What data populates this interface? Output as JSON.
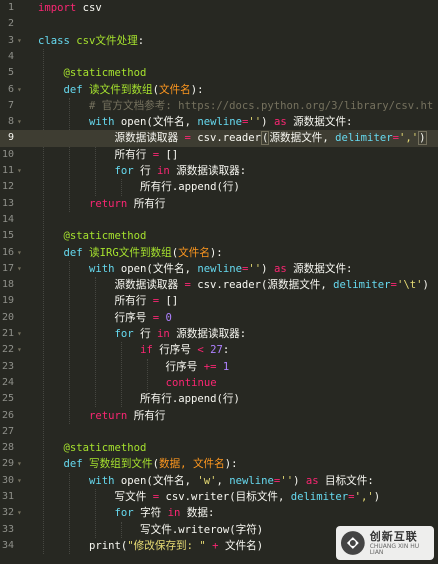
{
  "editor": {
    "theme_colors": {
      "background": "#272822",
      "keyword": "#66d9ef",
      "storage": "#f92672",
      "function": "#a6e22e",
      "string": "#e6db74",
      "number": "#ae81ff",
      "comment": "#75715e"
    },
    "active_line": 9,
    "lines": [
      {
        "n": "1",
        "fold": false,
        "tokens": [
          [
            "st",
            "import"
          ],
          [
            "pl",
            " csv"
          ]
        ]
      },
      {
        "n": "2",
        "fold": false,
        "tokens": []
      },
      {
        "n": "3",
        "fold": true,
        "tokens": [
          [
            "kw",
            "class"
          ],
          [
            "pl",
            " "
          ],
          [
            "fn",
            "csv文件处理"
          ],
          [
            "pl",
            ":"
          ]
        ]
      },
      {
        "n": "4",
        "fold": false,
        "tokens": []
      },
      {
        "n": "5",
        "fold": false,
        "tokens": [
          [
            "pl",
            "    "
          ],
          [
            "dc",
            "@staticmethod"
          ]
        ]
      },
      {
        "n": "6",
        "fold": true,
        "tokens": [
          [
            "pl",
            "    "
          ],
          [
            "kw",
            "def"
          ],
          [
            "pl",
            " "
          ],
          [
            "fn",
            "读文件到数组"
          ],
          [
            "pl",
            "("
          ],
          [
            "str2",
            "文件名"
          ],
          [
            "pl",
            "):"
          ]
        ]
      },
      {
        "n": "7",
        "fold": false,
        "tokens": [
          [
            "pl",
            "        "
          ],
          [
            "cm",
            "# 官方文档参考: https://docs.python.org/3/library/csv.ht"
          ]
        ]
      },
      {
        "n": "8",
        "fold": true,
        "tokens": [
          [
            "pl",
            "        "
          ],
          [
            "kw",
            "with"
          ],
          [
            "pl",
            " open(文件名, "
          ],
          [
            "kw",
            "newline"
          ],
          [
            "st",
            "="
          ],
          [
            "str",
            "''"
          ],
          [
            "pl",
            ") "
          ],
          [
            "st",
            "as"
          ],
          [
            "pl",
            " 源数据文件:"
          ]
        ]
      },
      {
        "n": "9",
        "fold": false,
        "tokens": [
          [
            "pl",
            "            源数据读取器 "
          ],
          [
            "st",
            "="
          ],
          [
            "pl",
            " csv.reader"
          ],
          [
            "br",
            "("
          ],
          [
            "pl",
            "源数据文件, "
          ],
          [
            "kw",
            "delimiter"
          ],
          [
            "st",
            "="
          ],
          [
            "str",
            "','"
          ],
          [
            "br",
            ")"
          ]
        ]
      },
      {
        "n": "10",
        "fold": false,
        "tokens": [
          [
            "pl",
            "            所有行 "
          ],
          [
            "st",
            "="
          ],
          [
            "pl",
            " []"
          ]
        ]
      },
      {
        "n": "11",
        "fold": true,
        "tokens": [
          [
            "pl",
            "            "
          ],
          [
            "kw",
            "for"
          ],
          [
            "pl",
            " 行 "
          ],
          [
            "st",
            "in"
          ],
          [
            "pl",
            " 源数据读取器:"
          ]
        ]
      },
      {
        "n": "12",
        "fold": false,
        "tokens": [
          [
            "pl",
            "                所有行.append(行)"
          ]
        ]
      },
      {
        "n": "13",
        "fold": false,
        "tokens": [
          [
            "pl",
            "        "
          ],
          [
            "st",
            "return"
          ],
          [
            "pl",
            " 所有行"
          ]
        ]
      },
      {
        "n": "14",
        "fold": false,
        "tokens": []
      },
      {
        "n": "15",
        "fold": false,
        "tokens": [
          [
            "pl",
            "    "
          ],
          [
            "dc",
            "@staticmethod"
          ]
        ]
      },
      {
        "n": "16",
        "fold": true,
        "tokens": [
          [
            "pl",
            "    "
          ],
          [
            "kw",
            "def"
          ],
          [
            "pl",
            " "
          ],
          [
            "fn",
            "读IRG文件到数组"
          ],
          [
            "pl",
            "("
          ],
          [
            "str2",
            "文件名"
          ],
          [
            "pl",
            "):"
          ]
        ]
      },
      {
        "n": "17",
        "fold": true,
        "tokens": [
          [
            "pl",
            "        "
          ],
          [
            "kw",
            "with"
          ],
          [
            "pl",
            " open(文件名, "
          ],
          [
            "kw",
            "newline"
          ],
          [
            "st",
            "="
          ],
          [
            "str",
            "''"
          ],
          [
            "pl",
            ") "
          ],
          [
            "st",
            "as"
          ],
          [
            "pl",
            " 源数据文件:"
          ]
        ]
      },
      {
        "n": "18",
        "fold": false,
        "tokens": [
          [
            "pl",
            "            源数据读取器 "
          ],
          [
            "st",
            "="
          ],
          [
            "pl",
            " csv.reader(源数据文件, "
          ],
          [
            "kw",
            "delimiter"
          ],
          [
            "st",
            "="
          ],
          [
            "str",
            "'\\t'"
          ],
          [
            "pl",
            ")"
          ]
        ]
      },
      {
        "n": "19",
        "fold": false,
        "tokens": [
          [
            "pl",
            "            所有行 "
          ],
          [
            "st",
            "="
          ],
          [
            "pl",
            " []"
          ]
        ]
      },
      {
        "n": "20",
        "fold": false,
        "tokens": [
          [
            "pl",
            "            行序号 "
          ],
          [
            "st",
            "="
          ],
          [
            "pl",
            " "
          ],
          [
            "num",
            "0"
          ]
        ]
      },
      {
        "n": "21",
        "fold": true,
        "tokens": [
          [
            "pl",
            "            "
          ],
          [
            "kw",
            "for"
          ],
          [
            "pl",
            " 行 "
          ],
          [
            "st",
            "in"
          ],
          [
            "pl",
            " 源数据读取器:"
          ]
        ]
      },
      {
        "n": "22",
        "fold": true,
        "tokens": [
          [
            "pl",
            "                "
          ],
          [
            "st",
            "if"
          ],
          [
            "pl",
            " 行序号 "
          ],
          [
            "st",
            "<"
          ],
          [
            "pl",
            " "
          ],
          [
            "num",
            "27"
          ],
          [
            "pl",
            ":"
          ]
        ]
      },
      {
        "n": "23",
        "fold": false,
        "tokens": [
          [
            "pl",
            "                    行序号 "
          ],
          [
            "st",
            "+="
          ],
          [
            "pl",
            " "
          ],
          [
            "num",
            "1"
          ]
        ]
      },
      {
        "n": "24",
        "fold": false,
        "tokens": [
          [
            "pl",
            "                    "
          ],
          [
            "st",
            "continue"
          ]
        ]
      },
      {
        "n": "25",
        "fold": false,
        "tokens": [
          [
            "pl",
            "                所有行.append(行)"
          ]
        ]
      },
      {
        "n": "26",
        "fold": false,
        "tokens": [
          [
            "pl",
            "        "
          ],
          [
            "st",
            "return"
          ],
          [
            "pl",
            " 所有行"
          ]
        ]
      },
      {
        "n": "27",
        "fold": false,
        "tokens": []
      },
      {
        "n": "28",
        "fold": false,
        "tokens": [
          [
            "pl",
            "    "
          ],
          [
            "dc",
            "@staticmethod"
          ]
        ]
      },
      {
        "n": "29",
        "fold": true,
        "tokens": [
          [
            "pl",
            "    "
          ],
          [
            "kw",
            "def"
          ],
          [
            "pl",
            " "
          ],
          [
            "fn",
            "写数组到文件"
          ],
          [
            "pl",
            "("
          ],
          [
            "str2",
            "数据, 文件名"
          ],
          [
            "pl",
            "):"
          ]
        ]
      },
      {
        "n": "30",
        "fold": true,
        "tokens": [
          [
            "pl",
            "        "
          ],
          [
            "kw",
            "with"
          ],
          [
            "pl",
            " open(文件名, "
          ],
          [
            "str",
            "'w'"
          ],
          [
            "pl",
            ", "
          ],
          [
            "kw",
            "newline"
          ],
          [
            "st",
            "="
          ],
          [
            "str",
            "''"
          ],
          [
            "pl",
            ") "
          ],
          [
            "st",
            "as"
          ],
          [
            "pl",
            " 目标文件:"
          ]
        ]
      },
      {
        "n": "31",
        "fold": false,
        "tokens": [
          [
            "pl",
            "            写文件 "
          ],
          [
            "st",
            "="
          ],
          [
            "pl",
            " csv.writer(目标文件, "
          ],
          [
            "kw",
            "delimiter"
          ],
          [
            "st",
            "="
          ],
          [
            "str",
            "','"
          ],
          [
            "pl",
            ")"
          ]
        ]
      },
      {
        "n": "32",
        "fold": true,
        "tokens": [
          [
            "pl",
            "            "
          ],
          [
            "kw",
            "for"
          ],
          [
            "pl",
            " 字符 "
          ],
          [
            "st",
            "in"
          ],
          [
            "pl",
            " 数据:"
          ]
        ]
      },
      {
        "n": "33",
        "fold": false,
        "tokens": [
          [
            "pl",
            "                写文件.writerow(字符)"
          ]
        ]
      },
      {
        "n": "34",
        "fold": false,
        "tokens": [
          [
            "pl",
            "        print("
          ],
          [
            "str",
            "\"修改保存到: \""
          ],
          [
            "pl",
            " "
          ],
          [
            "st",
            "+"
          ],
          [
            "pl",
            " 文件名)"
          ]
        ]
      }
    ]
  },
  "watermark": {
    "brand_cn": "创新互联",
    "brand_en": "CHUANG XIN HU LIAN"
  }
}
